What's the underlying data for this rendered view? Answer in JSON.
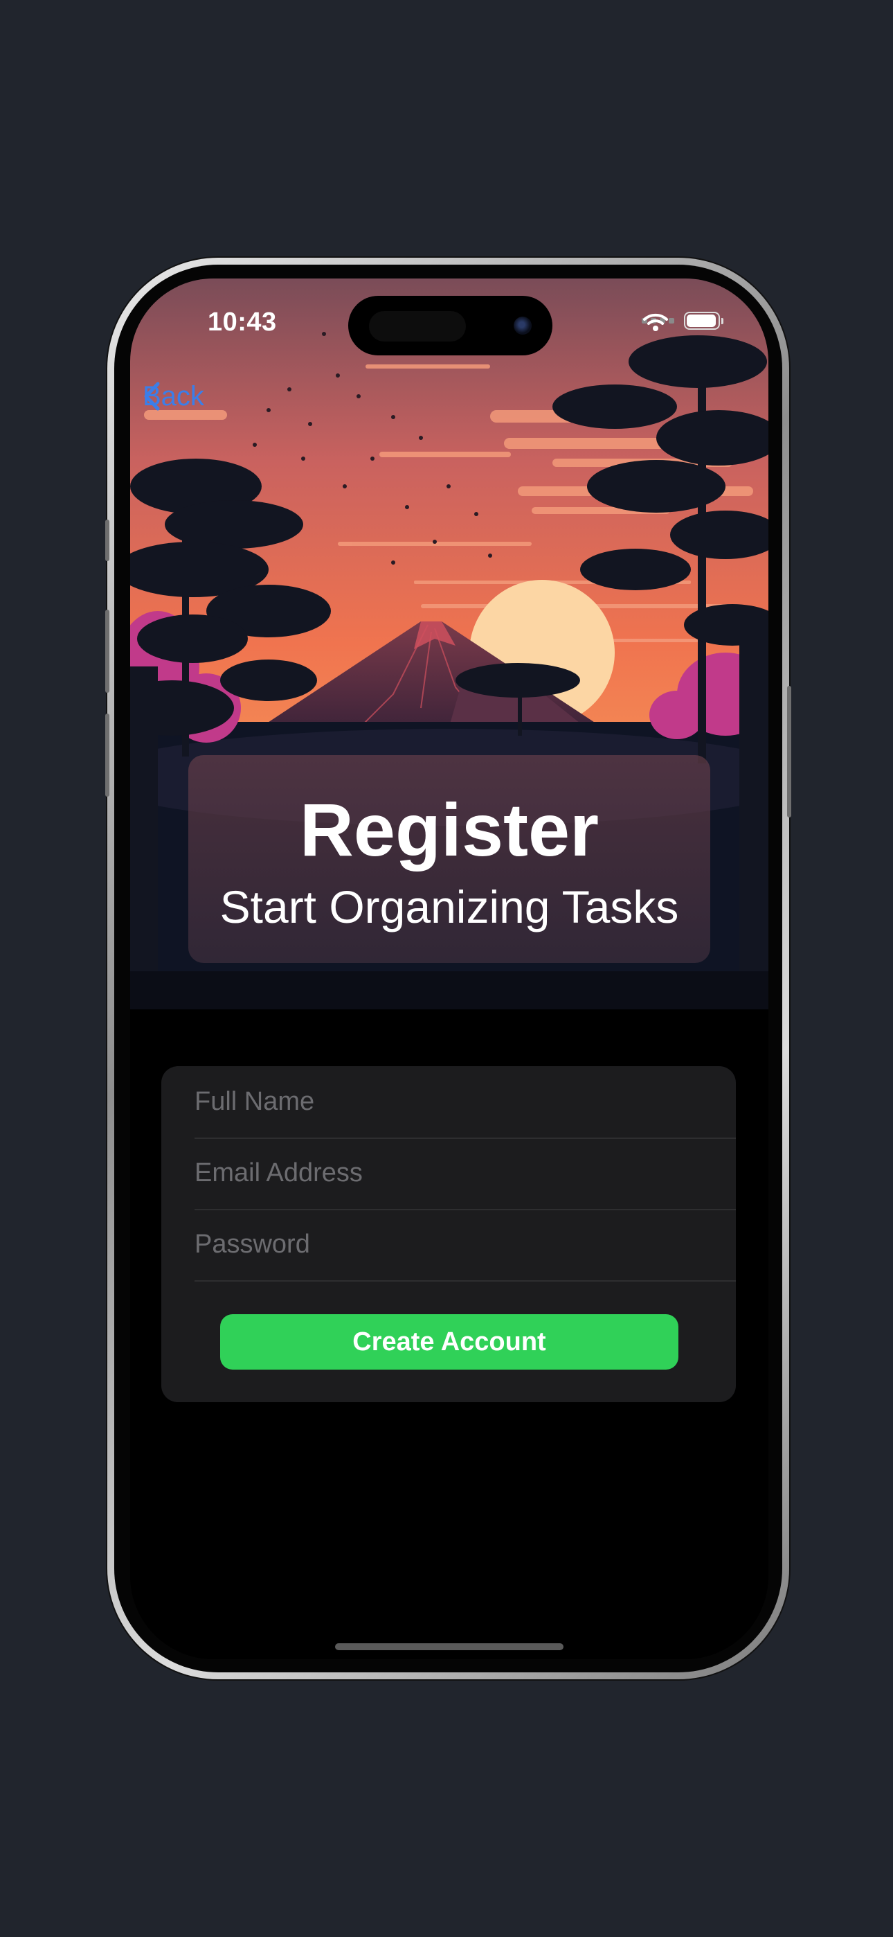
{
  "status_bar": {
    "time": "10:43"
  },
  "nav": {
    "back_label": "Back"
  },
  "header": {
    "title": "Register",
    "subtitle": "Start Organizing Tasks"
  },
  "form": {
    "full_name": {
      "placeholder": "Full Name",
      "value": ""
    },
    "email": {
      "placeholder": "Email Address",
      "value": ""
    },
    "password": {
      "placeholder": "Password",
      "value": ""
    },
    "submit_label": "Create Account"
  },
  "colors": {
    "background": "#21252d",
    "accent_blue": "#3b7ee8",
    "button_green": "#30d158",
    "form_background": "#1c1c1e"
  }
}
